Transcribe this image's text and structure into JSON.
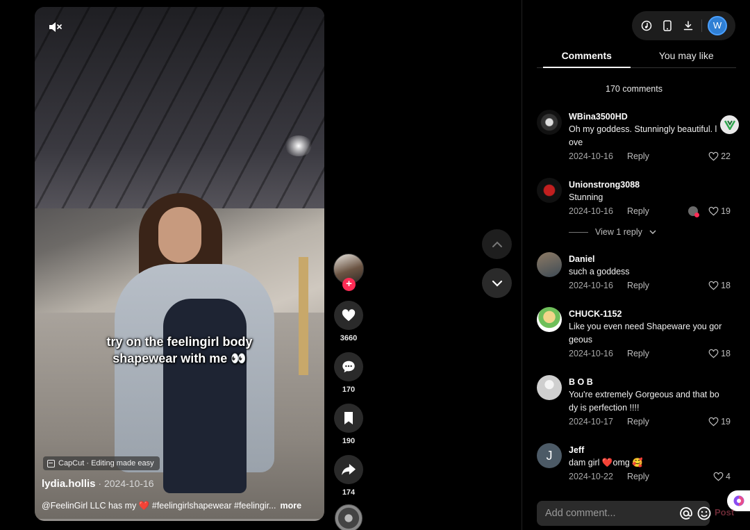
{
  "video": {
    "caption_line1": "try on the feelingirl body",
    "caption_line2": "shapewear with me 👀",
    "capcut_label": "CapCut · Editing made easy",
    "author": "lydia.hollis",
    "separator": " · ",
    "date": "2024-10-16",
    "description": "@FeelinGirl LLC has my ",
    "description_heart": "❤️",
    "description_tags": " #feelingirlshapewear #feelingir...",
    "more_label": "more",
    "progress_fraction": 0.015
  },
  "rail": {
    "follow_label": "+",
    "likes": "3660",
    "comments": "170",
    "saves": "190",
    "shares": "174"
  },
  "tabs": {
    "comments": "Comments",
    "you_may_like": "You may like"
  },
  "comment_count": "170 comments",
  "comments": [
    {
      "user": "WBina3500HD",
      "text": "Oh my goddess. Stunningly beautiful. l ove",
      "date": "2024-10-16",
      "reply": "Reply",
      "likes": "22"
    },
    {
      "user": "Unionstrong3088",
      "text": "Stunning",
      "date": "2024-10-16",
      "reply": "Reply",
      "likes": "19",
      "view_replies": "View 1 reply"
    },
    {
      "user": "Daniel",
      "text": "such a goddess",
      "date": "2024-10-16",
      "reply": "Reply",
      "likes": "18"
    },
    {
      "user": "CHUCK-1152",
      "text": "Like you even need Shapeware you gor geous",
      "date": "2024-10-16",
      "reply": "Reply",
      "likes": "18"
    },
    {
      "user": "B O B",
      "text": "You're extremely Gorgeous and that bo dy is perfection !!!!",
      "date": "2024-10-17",
      "reply": "Reply",
      "likes": "19"
    },
    {
      "user": "Jeff",
      "text": "dam girl ❤️omg 🥰",
      "date": "2024-10-22",
      "reply": "Reply",
      "likes": "4",
      "avatar_letter": "J"
    }
  ],
  "toolbar": {
    "user_initial": "W"
  },
  "input": {
    "placeholder": "Add comment...",
    "post_label": "Post"
  },
  "colors": {
    "accent": "#fe2c55",
    "background": "#000000",
    "panel": "#2b2b2b"
  },
  "icons": [
    "mute-icon",
    "heart-icon",
    "comment-icon",
    "bookmark-icon",
    "share-icon",
    "chevron-up-icon",
    "chevron-down-icon",
    "music-note-icon",
    "phone-icon",
    "download-icon",
    "at-icon",
    "emoji-icon"
  ]
}
